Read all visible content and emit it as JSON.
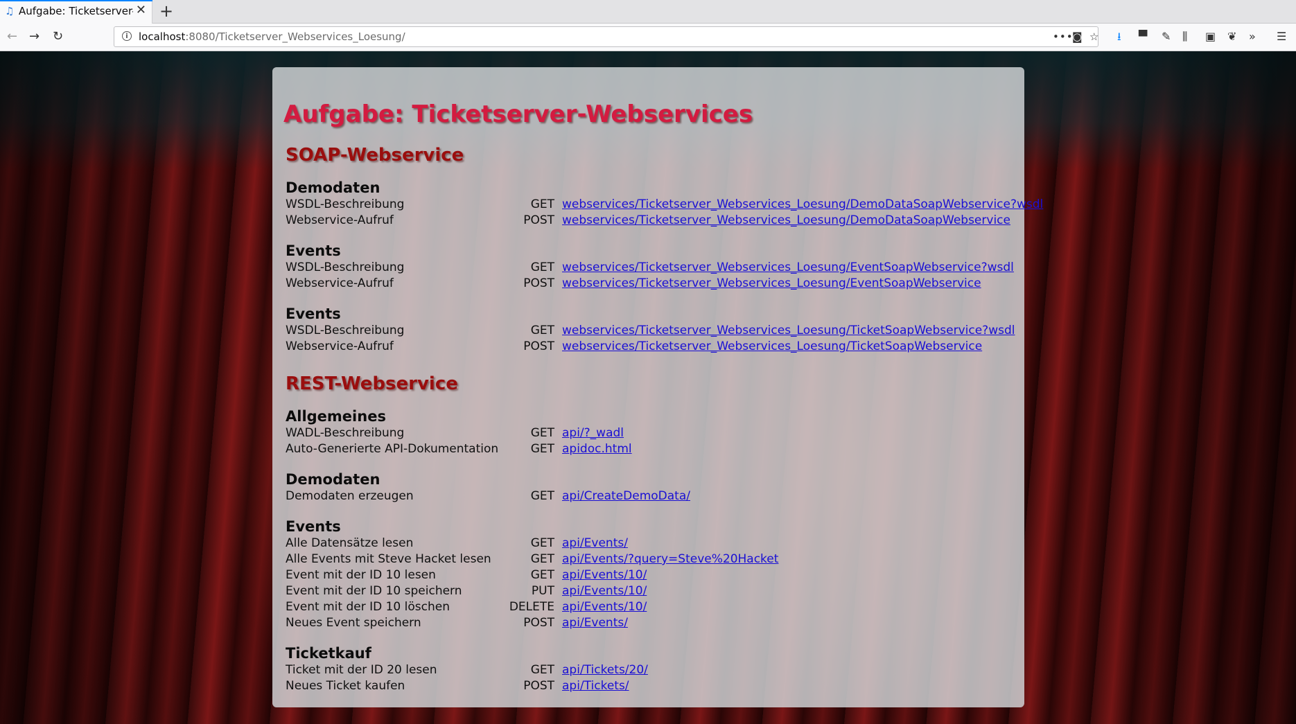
{
  "browser": {
    "tab_title": "Aufgabe: Ticketserver-Webservices",
    "url_host": "localhost",
    "url_path": ":8080/Ticketserver_Webservices_Loesung/"
  },
  "page": {
    "title": "Aufgabe: Ticketserver-Webservices",
    "soap": {
      "heading": "SOAP-Webservice",
      "groups": [
        {
          "title": "Demodaten",
          "rows": [
            {
              "desc": "WSDL-Beschreibung",
              "method": "GET",
              "link": "webservices/Ticketserver_Webservices_Loesung/DemoDataSoapWebservice?wsdl"
            },
            {
              "desc": "Webservice-Aufruf",
              "method": "POST",
              "link": "webservices/Ticketserver_Webservices_Loesung/DemoDataSoapWebservice"
            }
          ]
        },
        {
          "title": "Events",
          "rows": [
            {
              "desc": "WSDL-Beschreibung",
              "method": "GET",
              "link": "webservices/Ticketserver_Webservices_Loesung/EventSoapWebservice?wsdl"
            },
            {
              "desc": "Webservice-Aufruf",
              "method": "POST",
              "link": "webservices/Ticketserver_Webservices_Loesung/EventSoapWebservice"
            }
          ]
        },
        {
          "title": "Events",
          "rows": [
            {
              "desc": "WSDL-Beschreibung",
              "method": "GET",
              "link": "webservices/Ticketserver_Webservices_Loesung/TicketSoapWebservice?wsdl"
            },
            {
              "desc": "Webservice-Aufruf",
              "method": "POST",
              "link": "webservices/Ticketserver_Webservices_Loesung/TicketSoapWebservice"
            }
          ]
        }
      ]
    },
    "rest": {
      "heading": "REST-Webservice",
      "groups": [
        {
          "title": "Allgemeines",
          "rows": [
            {
              "desc": "WADL-Beschreibung",
              "method": "GET",
              "link": "api/?_wadl"
            },
            {
              "desc": "Auto-Generierte API-Dokumentation",
              "method": "GET",
              "link": "apidoc.html"
            }
          ]
        },
        {
          "title": "Demodaten",
          "rows": [
            {
              "desc": "Demodaten erzeugen",
              "method": "GET",
              "link": "api/CreateDemoData/"
            }
          ]
        },
        {
          "title": "Events",
          "rows": [
            {
              "desc": "Alle Datensätze lesen",
              "method": "GET",
              "link": "api/Events/"
            },
            {
              "desc": "Alle Events mit Steve Hacket lesen",
              "method": "GET",
              "link": "api/Events/?query=Steve%20Hacket"
            },
            {
              "desc": "Event mit der ID 10 lesen",
              "method": "GET",
              "link": "api/Events/10/"
            },
            {
              "desc": "Event mit der ID 10 speichern",
              "method": "PUT",
              "link": "api/Events/10/"
            },
            {
              "desc": "Event mit der ID 10 löschen",
              "method": "DELETE",
              "link": "api/Events/10/"
            },
            {
              "desc": "Neues Event speichern",
              "method": "POST",
              "link": "api/Events/"
            }
          ]
        },
        {
          "title": "Ticketkauf",
          "rows": [
            {
              "desc": "Ticket mit der ID 20 lesen",
              "method": "GET",
              "link": "api/Tickets/20/"
            },
            {
              "desc": "Neues Ticket kaufen",
              "method": "POST",
              "link": "api/Tickets/"
            }
          ]
        }
      ]
    }
  }
}
